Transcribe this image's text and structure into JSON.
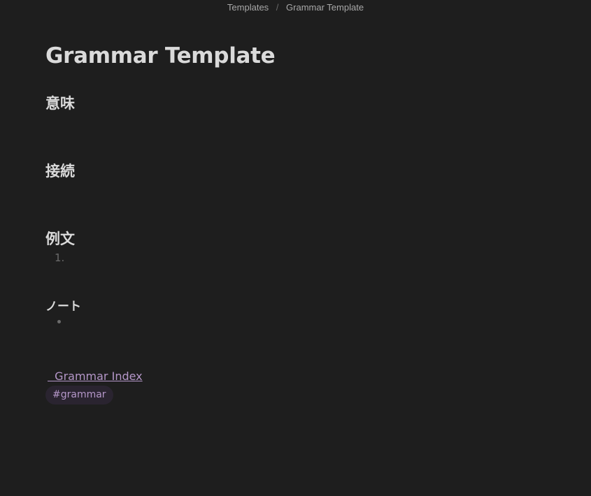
{
  "breadcrumb": {
    "items": [
      "Templates",
      "Grammar Template"
    ],
    "separator": "/"
  },
  "note": {
    "title": "Grammar Template",
    "sections": {
      "meaning": "意味",
      "connection": "接続",
      "examples": "例文",
      "notes": "ノート"
    },
    "examples_list_marker": "1.",
    "link_text": "  Grammar Index",
    "tag": "#grammar"
  },
  "colors": {
    "background": "#1e1e1e",
    "text": "#dadada",
    "accent": "#b597c9",
    "muted": "#6b6b6b"
  }
}
